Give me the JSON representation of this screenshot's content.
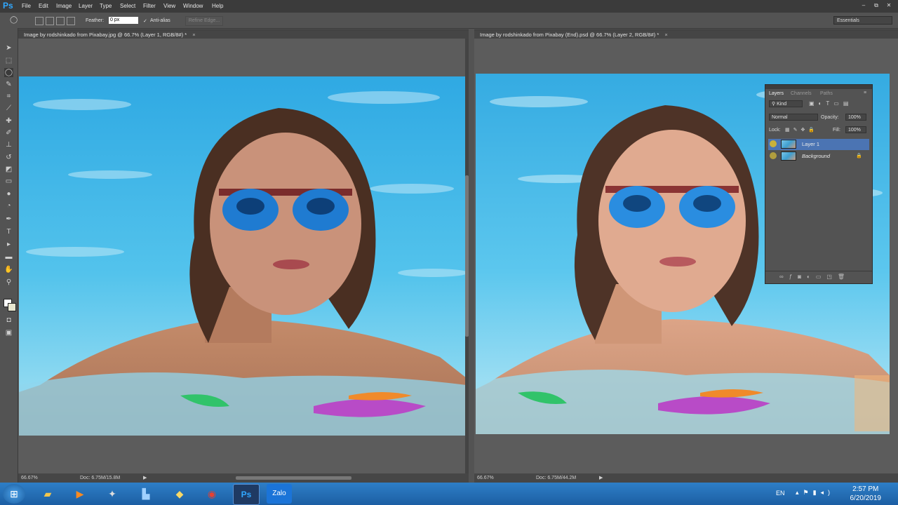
{
  "app": {
    "logo": "Ps",
    "menus": [
      "File",
      "Edit",
      "Image",
      "Layer",
      "Type",
      "Select",
      "Filter",
      "View",
      "Window",
      "Help"
    ],
    "window_controls": [
      "–",
      "⧉",
      "✕"
    ]
  },
  "options_bar": {
    "feather_label": "Feather:",
    "feather_value": "0 px",
    "antialias_check": "✓",
    "antialias_label": "Anti-alias",
    "refine_edge_label": "Refine Edge...",
    "workspace": "Essentials"
  },
  "documents": [
    {
      "tab_title": "Image by rodshinkado from Pixabay.jpg @ 66.7% (Layer 1, RGB/8#) *",
      "close": "×",
      "zoom": "66.67%",
      "doc_info": "Doc: 6.75M/15.8M"
    },
    {
      "tab_title": "Image by rodshinkado from Pixabay (End).psd @ 66.7% (Layer 2, RGB/8#) *",
      "close": "×",
      "zoom": "66.67%",
      "doc_info": "Doc: 6.75M/44.2M"
    }
  ],
  "layers_panel": {
    "tabs": [
      "Layers",
      "Channels",
      "Paths"
    ],
    "filter_kind": "Kind",
    "blend_mode": "Normal",
    "opacity_label": "Opacity:",
    "opacity_value": "100%",
    "lock_label": "Lock:",
    "fill_label": "Fill:",
    "fill_value": "100%",
    "layers": [
      {
        "name": "Layer 1",
        "selected": true
      },
      {
        "name": "Background",
        "locked": true
      }
    ]
  },
  "taskbar": {
    "language": "EN",
    "time": "2:57 PM",
    "date": "6/20/2019"
  },
  "colors": {
    "ps_blue": "#31a8ff",
    "selected_layer": "#4b74b3",
    "taskbar": "#2e7fc7"
  }
}
